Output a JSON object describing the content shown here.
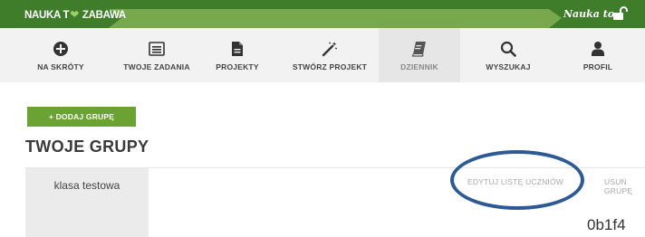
{
  "header": {
    "logo_text_left": "NAUKA T",
    "logo_text_right": "ZABAWA",
    "user_label": "Nauka to"
  },
  "nav": [
    {
      "label": "NA SKRÓTY",
      "icon": "plus-circle-icon"
    },
    {
      "label": "TWOJE ZADANIA",
      "icon": "list-icon"
    },
    {
      "label": "PROJEKTY",
      "icon": "document-icon"
    },
    {
      "label": "STWÓRZ PROJEKT",
      "icon": "magic-wand-icon"
    },
    {
      "label": "DZIENNIK",
      "icon": "book-icon",
      "active": true
    },
    {
      "label": "WYSZUKAJ",
      "icon": "search-icon"
    },
    {
      "label": "PROFIL",
      "icon": "user-icon"
    }
  ],
  "main": {
    "add_group_label": "+ DODAJ GRUPĘ",
    "title": "TWOJE GRUPY",
    "groups": [
      {
        "name": "klasa testowa",
        "edit_label": "EDYTUJ LISTĘ UCZNIÓW",
        "delete_label": "USUŃ GRUPĘ",
        "code": "0b1f4"
      }
    ]
  },
  "colors": {
    "header_dark_green": "#3f7d2a",
    "header_light_green": "#77a84c",
    "button_green": "#6aa233",
    "annotation_ellipse": "#2d5a94"
  }
}
